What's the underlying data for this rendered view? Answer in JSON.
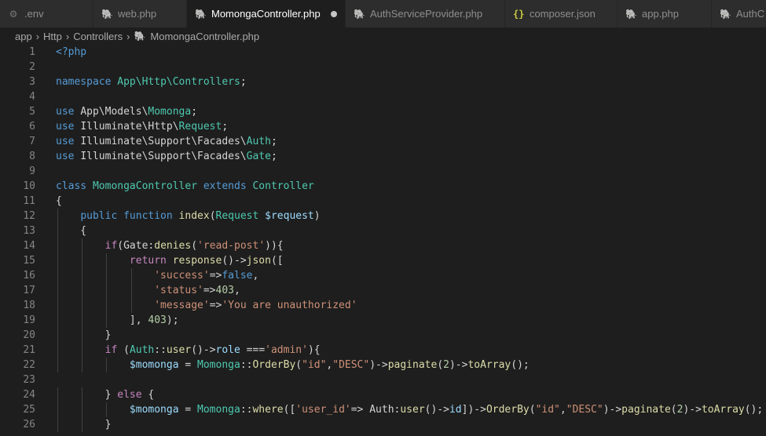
{
  "tabs": [
    {
      "label": ".env",
      "icon": "gear-icon"
    },
    {
      "label": "web.php",
      "icon": "php-elephant-icon"
    },
    {
      "label": "MomongaController.php",
      "icon": "php-elephant-icon",
      "active": true,
      "dirty": true
    },
    {
      "label": "AuthServiceProvider.php",
      "icon": "php-elephant-icon"
    },
    {
      "label": "composer.json",
      "icon": "json-braces-icon",
      "icon_glyph": "{}"
    },
    {
      "label": "app.php",
      "icon": "php-elephant-icon"
    },
    {
      "label": "AuthC",
      "icon": "php-elephant-icon"
    }
  ],
  "breadcrumb": [
    "app",
    "Http",
    "Controllers",
    "MomongaController.php"
  ],
  "editor": {
    "language": "php",
    "lines": [
      {
        "n": "1",
        "tokens": [
          [
            "tag",
            "<?php"
          ]
        ]
      },
      {
        "n": "2",
        "tokens": []
      },
      {
        "n": "3",
        "tokens": [
          [
            "kw",
            "namespace "
          ],
          [
            "cls",
            "App\\Http\\Controllers"
          ],
          [
            "txt",
            ";"
          ]
        ]
      },
      {
        "n": "4",
        "tokens": []
      },
      {
        "n": "5",
        "tokens": [
          [
            "kw",
            "use "
          ],
          [
            "txt",
            "App\\Models\\"
          ],
          [
            "cls",
            "Momonga"
          ],
          [
            "txt",
            ";"
          ]
        ]
      },
      {
        "n": "6",
        "tokens": [
          [
            "kw",
            "use "
          ],
          [
            "txt",
            "Illuminate\\Http\\"
          ],
          [
            "cls",
            "Request"
          ],
          [
            "txt",
            ";"
          ]
        ]
      },
      {
        "n": "7",
        "tokens": [
          [
            "kw",
            "use "
          ],
          [
            "txt",
            "Illuminate\\Support\\Facades\\"
          ],
          [
            "cls",
            "Auth"
          ],
          [
            "txt",
            ";"
          ]
        ]
      },
      {
        "n": "8",
        "tokens": [
          [
            "kw",
            "use "
          ],
          [
            "txt",
            "Illuminate\\Support\\Facades\\"
          ],
          [
            "cls",
            "Gate"
          ],
          [
            "txt",
            ";"
          ]
        ]
      },
      {
        "n": "9",
        "tokens": []
      },
      {
        "n": "10",
        "tokens": [
          [
            "kw",
            "class "
          ],
          [
            "cls",
            "MomongaController "
          ],
          [
            "kw",
            "extends "
          ],
          [
            "cls",
            "Controller"
          ]
        ]
      },
      {
        "n": "11",
        "tokens": [
          [
            "txt",
            "{"
          ]
        ]
      },
      {
        "n": "12",
        "tokens": [
          [
            "txt",
            "    "
          ],
          [
            "kw",
            "public function "
          ],
          [
            "fn",
            "index"
          ],
          [
            "txt",
            "("
          ],
          [
            "cls",
            "Request "
          ],
          [
            "var",
            "$request"
          ],
          [
            "txt",
            ")"
          ]
        ]
      },
      {
        "n": "13",
        "tokens": [
          [
            "txt",
            "    {"
          ]
        ]
      },
      {
        "n": "14",
        "tokens": [
          [
            "txt",
            "        "
          ],
          [
            "ctl",
            "if"
          ],
          [
            "txt",
            "(Gate:"
          ],
          [
            "fn",
            "denies"
          ],
          [
            "txt",
            "("
          ],
          [
            "str",
            "'read-post'"
          ],
          [
            "txt",
            "))"
          ],
          [
            "txt",
            "{"
          ]
        ]
      },
      {
        "n": "15",
        "tokens": [
          [
            "txt",
            "            "
          ],
          [
            "ctl",
            "return "
          ],
          [
            "fn",
            "response"
          ],
          [
            "txt",
            "()->"
          ],
          [
            "fn",
            "json"
          ],
          [
            "txt",
            "(["
          ]
        ]
      },
      {
        "n": "16",
        "tokens": [
          [
            "txt",
            "                "
          ],
          [
            "str",
            "'success'"
          ],
          [
            "txt",
            "=>"
          ],
          [
            "kw",
            "false"
          ],
          [
            "txt",
            ","
          ]
        ]
      },
      {
        "n": "17",
        "tokens": [
          [
            "txt",
            "                "
          ],
          [
            "str",
            "'status'"
          ],
          [
            "txt",
            "=>"
          ],
          [
            "num",
            "403"
          ],
          [
            "txt",
            ","
          ]
        ]
      },
      {
        "n": "18",
        "tokens": [
          [
            "txt",
            "                "
          ],
          [
            "str",
            "'message'"
          ],
          [
            "txt",
            "=>"
          ],
          [
            "str",
            "'You are unauthorized'"
          ]
        ]
      },
      {
        "n": "19",
        "tokens": [
          [
            "txt",
            "            ], "
          ],
          [
            "num",
            "403"
          ],
          [
            "txt",
            ");"
          ]
        ]
      },
      {
        "n": "20",
        "tokens": [
          [
            "txt",
            "        }"
          ]
        ]
      },
      {
        "n": "21",
        "tokens": [
          [
            "txt",
            "        "
          ],
          [
            "ctl",
            "if "
          ],
          [
            "txt",
            "("
          ],
          [
            "cls",
            "Auth"
          ],
          [
            "txt",
            "::"
          ],
          [
            "fn",
            "user"
          ],
          [
            "txt",
            "()->"
          ],
          [
            "var",
            "role "
          ],
          [
            "txt",
            "==="
          ],
          [
            "str",
            "'admin'"
          ],
          [
            "txt",
            "){"
          ]
        ]
      },
      {
        "n": "22",
        "tokens": [
          [
            "txt",
            "            "
          ],
          [
            "var",
            "$momonga "
          ],
          [
            "txt",
            "= "
          ],
          [
            "cls",
            "Momonga"
          ],
          [
            "txt",
            "::"
          ],
          [
            "fn",
            "OrderBy"
          ],
          [
            "txt",
            "("
          ],
          [
            "str",
            "\"id\""
          ],
          [
            "txt",
            ","
          ],
          [
            "str",
            "\"DESC\""
          ],
          [
            "txt",
            ")->"
          ],
          [
            "fn",
            "paginate"
          ],
          [
            "txt",
            "("
          ],
          [
            "num",
            "2"
          ],
          [
            "txt",
            ")->"
          ],
          [
            "fn",
            "toArray"
          ],
          [
            "txt",
            "();"
          ]
        ]
      },
      {
        "n": "23",
        "tokens": []
      },
      {
        "n": "24",
        "tokens": [
          [
            "txt",
            "        } "
          ],
          [
            "ctl",
            "else "
          ],
          [
            "txt",
            "{"
          ]
        ]
      },
      {
        "n": "25",
        "tokens": [
          [
            "txt",
            "            "
          ],
          [
            "var",
            "$momonga "
          ],
          [
            "txt",
            "= "
          ],
          [
            "cls",
            "Momonga"
          ],
          [
            "txt",
            "::"
          ],
          [
            "fn",
            "where"
          ],
          [
            "txt",
            "(["
          ],
          [
            "str",
            "'user_id'"
          ],
          [
            "txt",
            "=> Auth:"
          ],
          [
            "fn",
            "user"
          ],
          [
            "txt",
            "()->"
          ],
          [
            "var",
            "id"
          ],
          [
            "txt",
            "])->"
          ],
          [
            "fn",
            "OrderBy"
          ],
          [
            "txt",
            "("
          ],
          [
            "str",
            "\"id\""
          ],
          [
            "txt",
            ","
          ],
          [
            "str",
            "\"DESC\""
          ],
          [
            "txt",
            ")->"
          ],
          [
            "fn",
            "paginate"
          ],
          [
            "txt",
            "("
          ],
          [
            "num",
            "2"
          ],
          [
            "txt",
            ")->"
          ],
          [
            "fn",
            "toArray"
          ],
          [
            "txt",
            "();"
          ]
        ]
      },
      {
        "n": "26",
        "tokens": [
          [
            "txt",
            "        }"
          ]
        ]
      }
    ]
  },
  "colors": {
    "background": "#1e1e1e",
    "tab_inactive": "#2d2d2d",
    "keyword": "#569cd6",
    "control": "#c586c0",
    "class": "#4ec9b0",
    "function": "#dcdcaa",
    "variable": "#9cdcfe",
    "string": "#ce9178",
    "number": "#b5cea8"
  }
}
